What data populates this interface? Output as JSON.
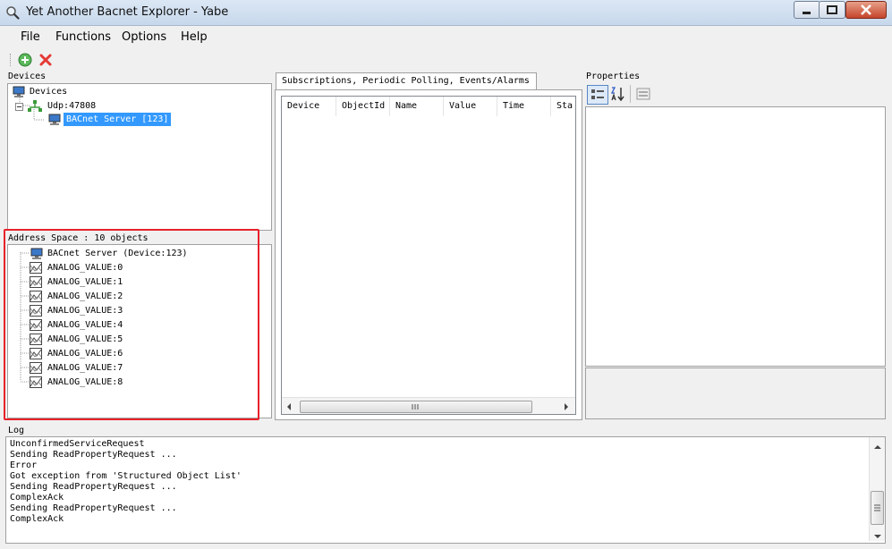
{
  "window": {
    "title": "Yet Another Bacnet Explorer - Yabe"
  },
  "menu": [
    "File",
    "Functions",
    "Options",
    "Help"
  ],
  "toolbar": {
    "add_icon": "add-icon",
    "remove_icon": "remove-icon"
  },
  "devices": {
    "label": "Devices",
    "tree": [
      {
        "label": "Devices",
        "icon": "computer-icon",
        "depth": 0
      },
      {
        "label": "Udp:47808",
        "icon": "network-icon",
        "depth": 1
      },
      {
        "label": "BACnet Server [123]",
        "icon": "computer-icon",
        "depth": 2,
        "selected": true
      }
    ]
  },
  "address_space": {
    "label": "Address Space : 10 objects",
    "items": [
      {
        "label": "BACnet Server (Device:123)",
        "icon": "device-icon"
      },
      {
        "label": "ANALOG_VALUE:0",
        "icon": "analog-value-icon"
      },
      {
        "label": "ANALOG_VALUE:1",
        "icon": "analog-value-icon"
      },
      {
        "label": "ANALOG_VALUE:2",
        "icon": "analog-value-icon"
      },
      {
        "label": "ANALOG_VALUE:3",
        "icon": "analog-value-icon"
      },
      {
        "label": "ANALOG_VALUE:4",
        "icon": "analog-value-icon"
      },
      {
        "label": "ANALOG_VALUE:5",
        "icon": "analog-value-icon"
      },
      {
        "label": "ANALOG_VALUE:6",
        "icon": "analog-value-icon"
      },
      {
        "label": "ANALOG_VALUE:7",
        "icon": "analog-value-icon"
      },
      {
        "label": "ANALOG_VALUE:8",
        "icon": "analog-value-icon"
      }
    ]
  },
  "subscriptions": {
    "tab_label": "Subscriptions, Periodic Polling, Events/Alarms",
    "columns": [
      "Device",
      "ObjectId",
      "Name",
      "Value",
      "Time",
      "Sta"
    ]
  },
  "properties": {
    "label": "Properties"
  },
  "log": {
    "label": "Log",
    "lines": [
      "UnconfirmedServiceRequest",
      "Sending ReadPropertyRequest ...",
      "Error",
      "Got exception from 'Structured Object List'",
      "Sending ReadPropertyRequest ...",
      "ComplexAck",
      "Sending ReadPropertyRequest ...",
      "ComplexAck"
    ]
  }
}
